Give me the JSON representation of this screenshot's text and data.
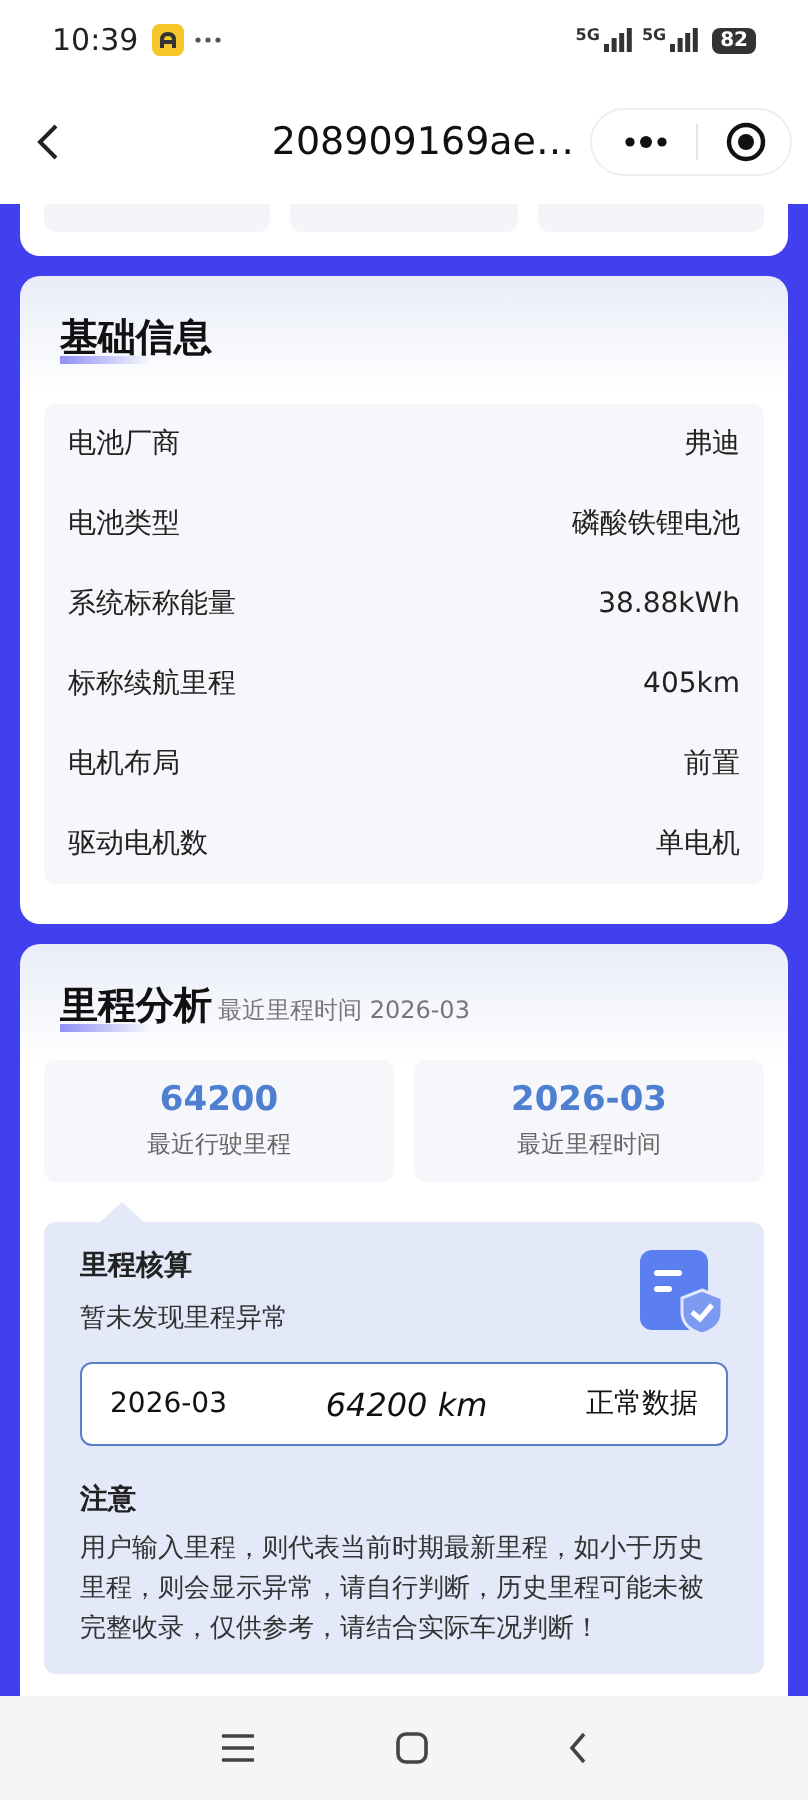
{
  "status_bar": {
    "time": "10:39",
    "network": [
      "5G",
      "5G"
    ],
    "battery": "82"
  },
  "nav": {
    "title": "208909169ae…"
  },
  "basic_info": {
    "title": "基础信息",
    "rows": [
      {
        "label": "电池厂商",
        "value": "弗迪"
      },
      {
        "label": "电池类型",
        "value": "磷酸铁锂电池"
      },
      {
        "label": "系统标称能量",
        "value": "38.88kWh"
      },
      {
        "label": "标称续航里程",
        "value": "405km"
      },
      {
        "label": "电机布局",
        "value": "前置"
      },
      {
        "label": "驱动电机数",
        "value": "单电机"
      }
    ]
  },
  "mileage": {
    "title": "里程分析",
    "subtitle": "最近里程时间 2026-03",
    "stats": [
      {
        "value": "64200",
        "label": "最近行驶里程"
      },
      {
        "value": "2026-03",
        "label": "最近里程时间"
      }
    ],
    "check": {
      "title": "里程核算",
      "status": "暂未发现里程异常",
      "record": {
        "date": "2026-03",
        "mileage": "64200 km",
        "status": "正常数据"
      },
      "note_title": "注意",
      "note": "用户输入里程，则代表当前时期最新里程，如小于历史里程，则会显示异常，请自行判断，历史里程可能未被完整收录，仅供参考，请结合实际车况判断！"
    }
  }
}
